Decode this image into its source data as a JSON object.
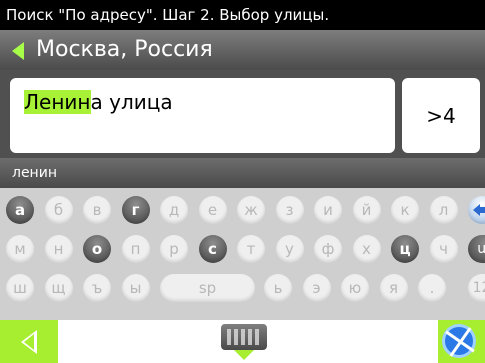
{
  "title": "Поиск \"По адресу\". Шаг 2. Выбор улицы.",
  "location": "Москва, Россия",
  "result": {
    "highlight": "Ленин",
    "rest": "а улица",
    "count": ">4"
  },
  "input_text": "ленин",
  "keyboard": {
    "row1": [
      "а",
      "б",
      "в",
      "г",
      "д",
      "е",
      "ж",
      "з",
      "и",
      "й",
      "к",
      "л"
    ],
    "row2": [
      "м",
      "н",
      "о",
      "п",
      "р",
      "с",
      "т",
      "у",
      "ф",
      "х",
      "ц",
      "ч"
    ],
    "row3": [
      "ш",
      "щ",
      "ъ",
      "ы",
      "sp",
      "ь",
      "э",
      "ю",
      "я",
      "."
    ],
    "lang_label": "ua",
    "num_label": "123",
    "backspace_icon": "backspace-arrow-icon",
    "active_keys": [
      "а",
      "г",
      "о",
      "с",
      "ц"
    ]
  },
  "bottom": {
    "back_icon": "back-triangle-icon",
    "keyboard_icon": "keyboard-icon",
    "globe_icon": "globe-icon"
  },
  "colors": {
    "accent": "#a7ee31",
    "highlight": "#a7f236",
    "title_bg": "#000000",
    "keyboard_bg": "#cfcfcf"
  }
}
